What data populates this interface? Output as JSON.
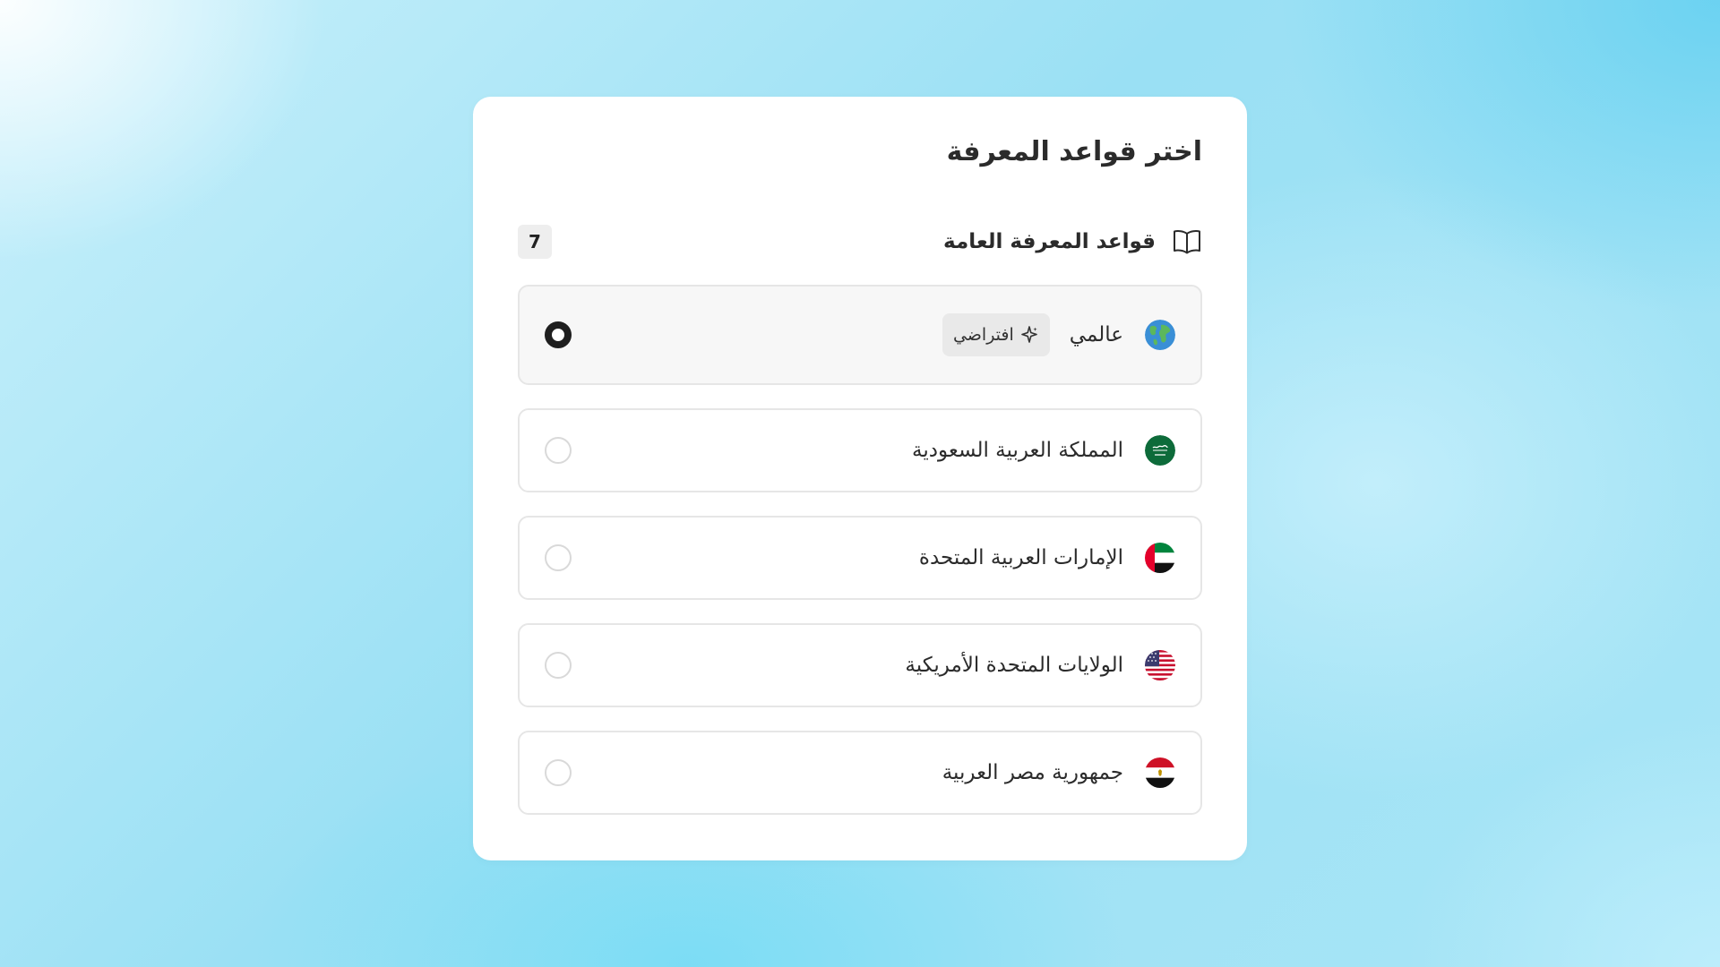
{
  "card": {
    "title": "اختر قواعد المعرفة",
    "section": {
      "label": "قواعد المعرفة العامة",
      "count": "7",
      "icon": "book-open-icon"
    }
  },
  "options": [
    {
      "label": "عالمي",
      "flag": "globe-icon",
      "badge": "افتراضي",
      "badge_icon": "sparkle-icon",
      "selected": true
    },
    {
      "label": "المملكة العربية السعودية",
      "flag": "saudi-flag-icon",
      "selected": false
    },
    {
      "label": "الإمارات العربية المتحدة",
      "flag": "uae-flag-icon",
      "selected": false
    },
    {
      "label": "الولايات المتحدة الأمريكية",
      "flag": "usa-flag-icon",
      "selected": false
    },
    {
      "label": "جمهورية مصر العربية",
      "flag": "egypt-flag-icon",
      "selected": false
    }
  ],
  "colors": {
    "text": "#2b2b2b",
    "border": "#e6e6e6",
    "selected_bg": "#f7f7f7",
    "radio_checked": "#1f1f1f"
  }
}
